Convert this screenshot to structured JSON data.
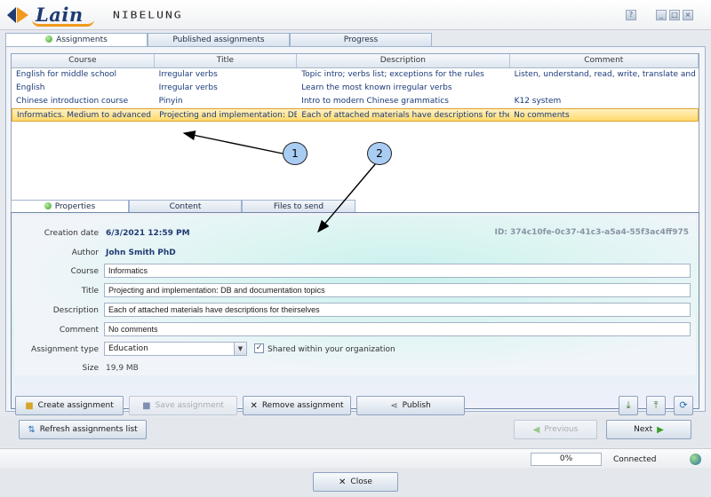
{
  "titlebar": {
    "logo": "Lain",
    "brand": "NIBELUNG",
    "help": "?",
    "minimize": "_",
    "maximize": "□",
    "close": "×"
  },
  "outer_tabs": [
    {
      "label": "Assignments",
      "active": true
    },
    {
      "label": "Published assignments",
      "active": false
    },
    {
      "label": "Progress",
      "active": false
    }
  ],
  "grid": {
    "columns": [
      "Course",
      "Title",
      "Description",
      "Comment"
    ],
    "rows": [
      [
        "English for middle school",
        "Irregular verbs",
        "Topic intro; verbs list; exceptions for the rules",
        "Listen, understand, read, write, translate and r"
      ],
      [
        "English",
        "Irregular verbs",
        "Learn the most known irregular verbs",
        ""
      ],
      [
        "Chinese introduction course",
        "Pinyin",
        "Intro to modern Chinese grammatics",
        "K12 system"
      ],
      [
        "Informatics. Medium to advanced",
        "Projecting and implementation: DB",
        "Each of attached materials have descriptions for theirse",
        "No comments"
      ]
    ],
    "selected_row": 3
  },
  "prop_tabs": [
    {
      "label": "Properties",
      "active": true
    },
    {
      "label": "Content",
      "active": false
    },
    {
      "label": "Files to send",
      "active": false
    }
  ],
  "properties": {
    "creation_date_label": "Creation date",
    "creation_date": "6/3/2021 12:59 PM",
    "id": "ID: 374c10fe-0c37-41c3-a5a4-55f3ac4ff975",
    "author_label": "Author",
    "author": "John Smith PhD",
    "course_label": "Course",
    "course": "Informatics",
    "title_label": "Title",
    "title": "Projecting and implementation: DB and documentation topics",
    "description_label": "Description",
    "description": "Each of attached materials have descriptions for theirselves",
    "comment_label": "Comment",
    "comment": "No comments",
    "type_label": "Assignment type",
    "type": "Education",
    "shared_label": "Shared within your organization",
    "shared": true,
    "size_label": "Size",
    "size": "19,9 MB"
  },
  "actions": {
    "create": "Create assignment",
    "save": "Save assignment",
    "remove": "Remove assignment",
    "publish": "Publish"
  },
  "nav": {
    "refresh": "Refresh assignments list",
    "previous": "Previous",
    "next": "Next"
  },
  "status": {
    "progress": "0%",
    "connection": "Connected"
  },
  "footer": {
    "close": "Close"
  },
  "annotations": [
    "1",
    "2"
  ]
}
